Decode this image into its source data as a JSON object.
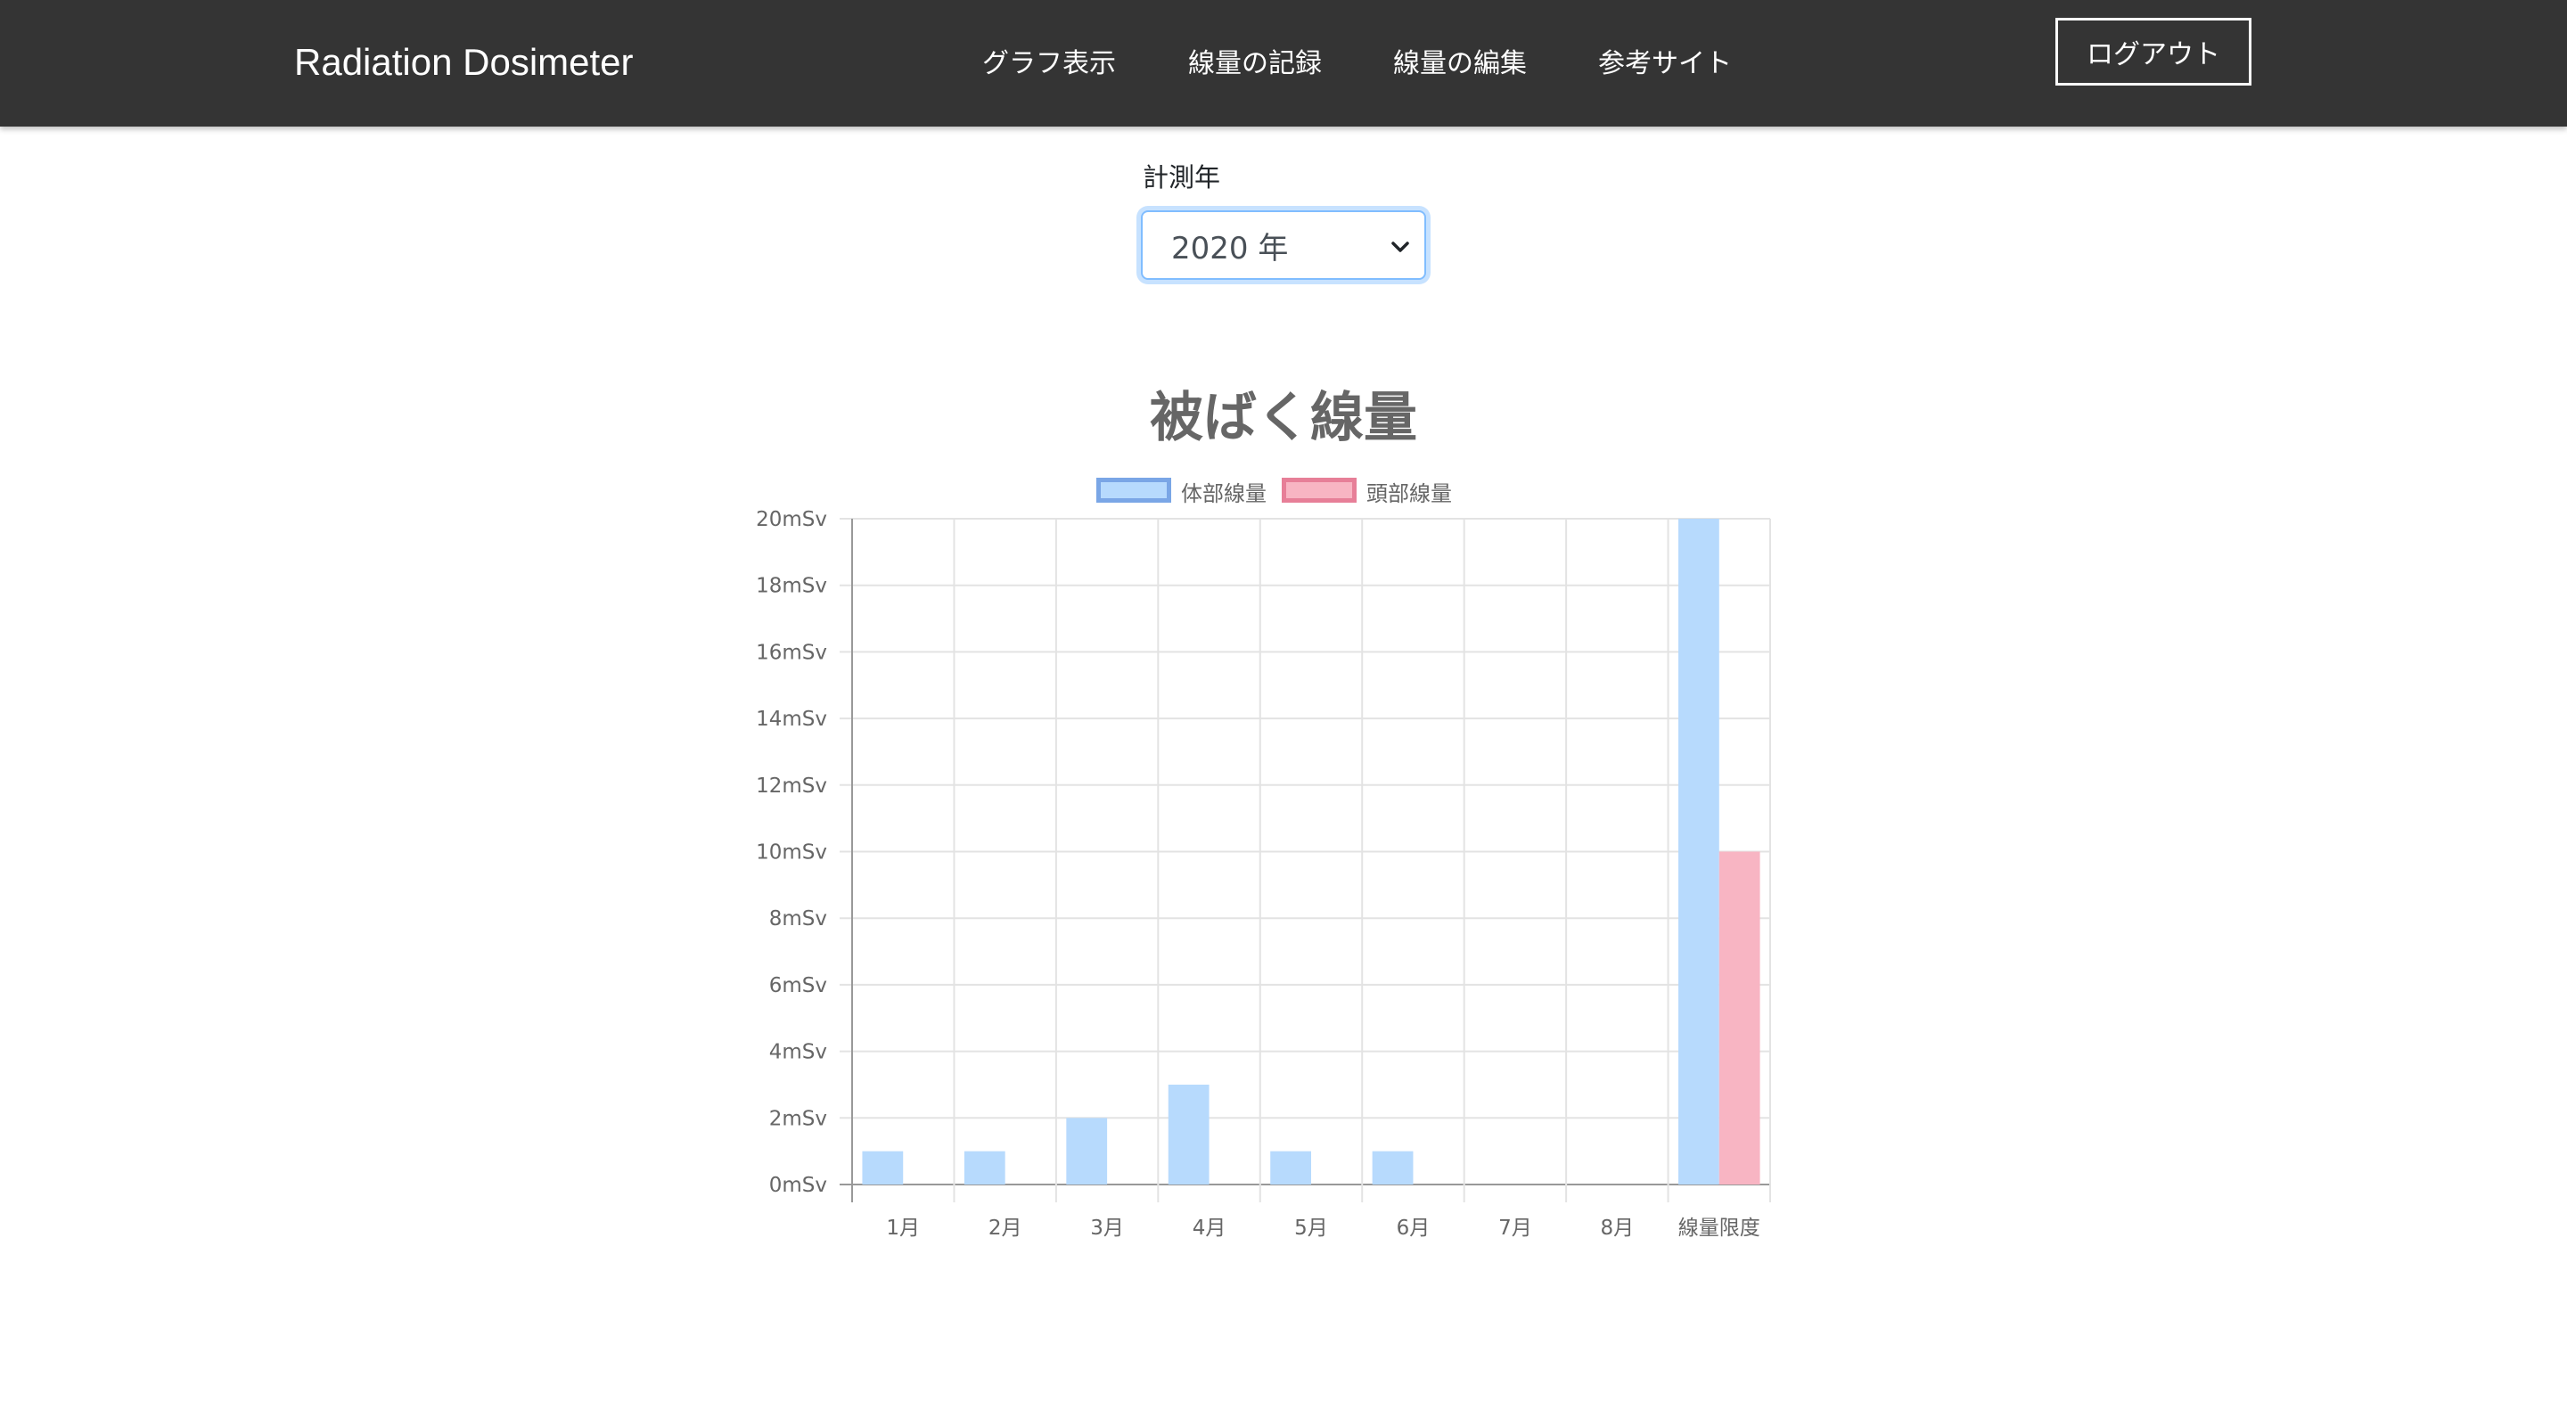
{
  "navbar": {
    "brand": "Radiation Dosimeter",
    "links": [
      "グラフ表示",
      "線量の記録",
      "線量の編集",
      "参考サイト"
    ],
    "logout_label": "ログアウト"
  },
  "year_filter": {
    "label": "計測年",
    "selected": "2020 年"
  },
  "colors": {
    "navbar_bg": "#343434",
    "body_bar": "#b7dafd",
    "body_border": "#7aa6e6",
    "head_bar": "#f8b5c3",
    "head_border": "#e77f98"
  },
  "chart_data": {
    "type": "bar",
    "title": "被ばく線量",
    "categories": [
      "1月",
      "2月",
      "3月",
      "4月",
      "5月",
      "6月",
      "7月",
      "8月",
      "線量限度"
    ],
    "series": [
      {
        "name": "体部線量",
        "values": [
          1,
          1,
          2,
          3,
          1,
          1,
          0,
          0,
          20
        ]
      },
      {
        "name": "頭部線量",
        "values": [
          0,
          0,
          0,
          0,
          0,
          0,
          0,
          0,
          10
        ]
      }
    ],
    "y_ticks": [
      "0mSv",
      "2mSv",
      "4mSv",
      "6mSv",
      "8mSv",
      "10mSv",
      "12mSv",
      "14mSv",
      "16mSv",
      "18mSv",
      "20mSv"
    ],
    "ylim": [
      0,
      20
    ],
    "y_unit": "mSv",
    "grid": true,
    "legend_position": "top"
  }
}
